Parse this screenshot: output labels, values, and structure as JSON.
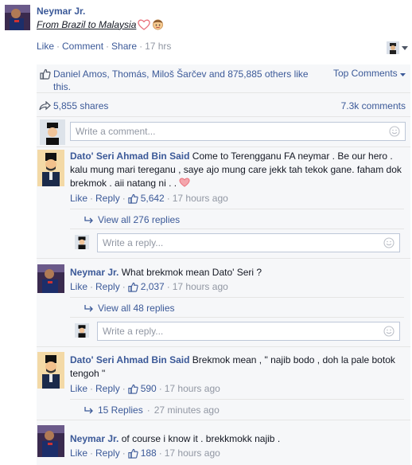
{
  "post": {
    "author": "Neymar Jr.",
    "caption": "From Brazil to Malaysia",
    "actions": [
      "Like",
      "Comment",
      "Share"
    ],
    "time": "17 hrs"
  },
  "ufi": {
    "likes_text": "Daniel Amos, Thomás, Miloš Šarčev and 875,885 others like this.",
    "top_comments": "Top Comments",
    "shares": "5,855 shares",
    "comments_count": "7.3k comments",
    "write_comment_placeholder": "Write a comment...",
    "write_reply_placeholder": "Write a reply..."
  },
  "comments": [
    {
      "author": "Dato' Seri Ahmad Bin Said",
      "text": "Come to Terengganu FA neymar . Be our hero . kalu mung mari tereganu , saye ajo mung care jekk tah tekok gane. faham dok brekmok . aii natang ni . .",
      "like": "Like",
      "reply": "Reply",
      "likes": "5,642",
      "time": "17 hours ago",
      "replies_link": "View all 276 replies"
    },
    {
      "author": "Neymar Jr.",
      "text": "What brekmok mean Dato' Seri ?",
      "like": "Like",
      "reply": "Reply",
      "likes": "2,037",
      "time": "17 hours ago",
      "replies_link": "View all 48 replies"
    },
    {
      "author": "Dato' Seri Ahmad Bin Said",
      "text": "Brekmok mean , \" najib bodo , doh la pale botok tengoh \"",
      "like": "Like",
      "reply": "Reply",
      "likes": "590",
      "time": "17 hours ago",
      "replies_link": "15 Replies",
      "replies_time": "27 minutes ago"
    },
    {
      "author": "Neymar Jr.",
      "text": "of course i know it . brekkmokk najib .",
      "like": "Like",
      "reply": "Reply",
      "likes": "188",
      "time": "17 hours ago"
    }
  ],
  "colors": {
    "link": "#3b5998",
    "muted": "#9197a3",
    "panel": "#f6f7f9",
    "heart": "#e9707b"
  },
  "icons": [
    "like-thumb-icon",
    "share-arrow-icon",
    "smiley-icon",
    "reply-arrow-icon",
    "heart-icon",
    "emoji-face-icon",
    "dropdown-caret-icon"
  ]
}
